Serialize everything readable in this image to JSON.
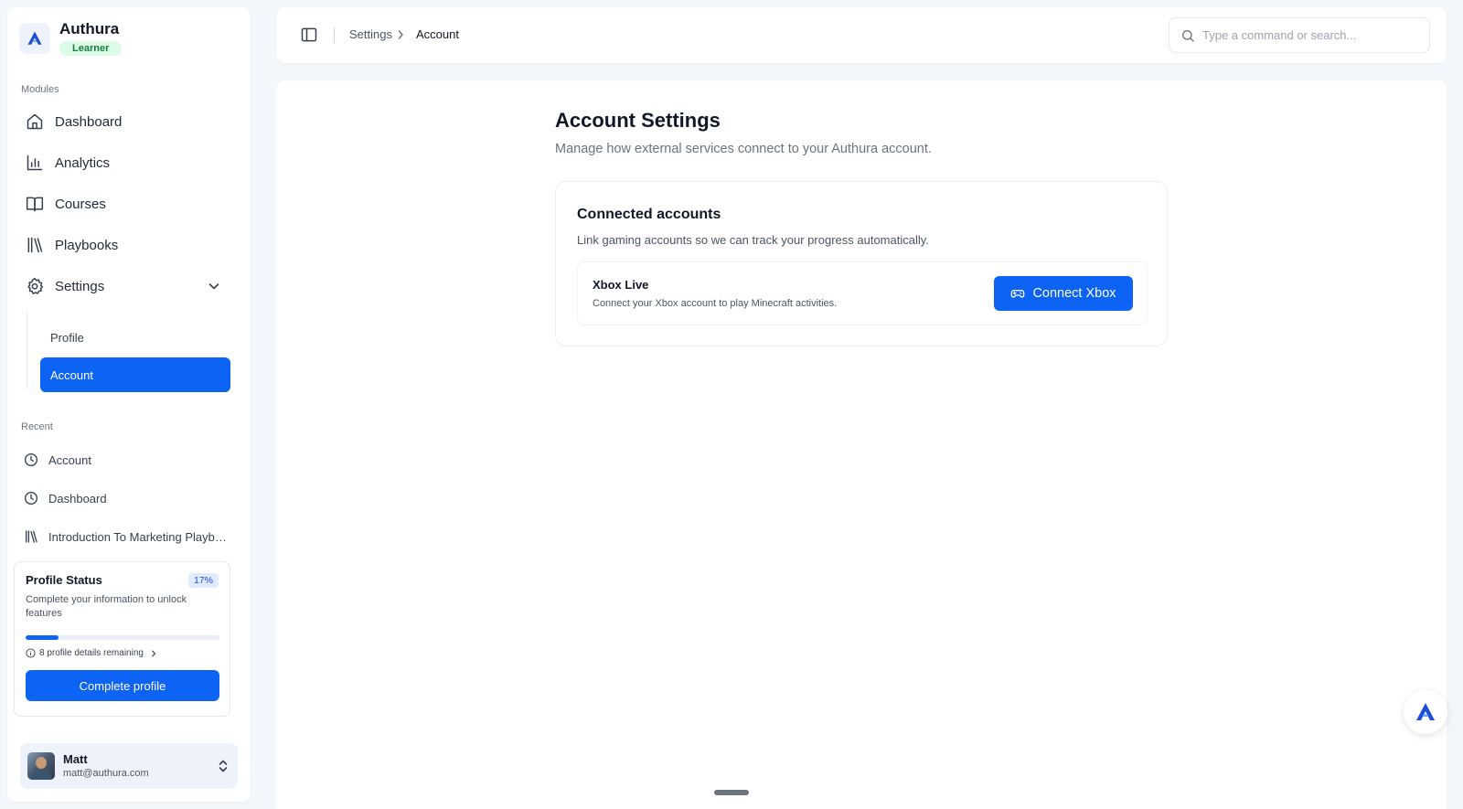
{
  "brand": {
    "name": "Authura",
    "badge": "Learner"
  },
  "sidebar": {
    "modules_label": "Modules",
    "items": [
      {
        "label": "Dashboard",
        "icon": "home-icon"
      },
      {
        "label": "Analytics",
        "icon": "bar-chart-icon"
      },
      {
        "label": "Courses",
        "icon": "book-open-icon"
      },
      {
        "label": "Playbooks",
        "icon": "library-icon"
      },
      {
        "label": "Settings",
        "icon": "gear-icon"
      }
    ],
    "settings_sub": [
      {
        "label": "Profile"
      },
      {
        "label": "Account",
        "active": true
      }
    ],
    "recent_label": "Recent",
    "recent": [
      {
        "label": "Account",
        "icon": "clock-icon"
      },
      {
        "label": "Dashboard",
        "icon": "clock-icon"
      },
      {
        "label": "Introduction To Marketing Playbook",
        "icon": "library-icon"
      }
    ]
  },
  "profile_status": {
    "title": "Profile Status",
    "percent_label": "17%",
    "percent": 17,
    "description": "Complete your information to unlock features",
    "remaining": "8 profile details remaining",
    "button": "Complete profile"
  },
  "user": {
    "name": "Matt",
    "email": "matt@authura.com"
  },
  "topbar": {
    "breadcrumb": [
      "Settings",
      "Account"
    ],
    "search_placeholder": "Type a command or search..."
  },
  "main": {
    "title": "Account Settings",
    "subtitle": "Manage how external services connect to your Authura account.",
    "card": {
      "title": "Connected accounts",
      "subtitle": "Link gaming accounts so we can track your progress automatically.",
      "service": {
        "name": "Xbox Live",
        "description": "Connect your Xbox account to play Minecraft activities.",
        "button": "Connect Xbox"
      }
    }
  },
  "colors": {
    "accent": "#0d63f3",
    "badge_bg": "#dcfce7",
    "badge_text": "#15803d",
    "page_bg": "#f3f6fa"
  }
}
